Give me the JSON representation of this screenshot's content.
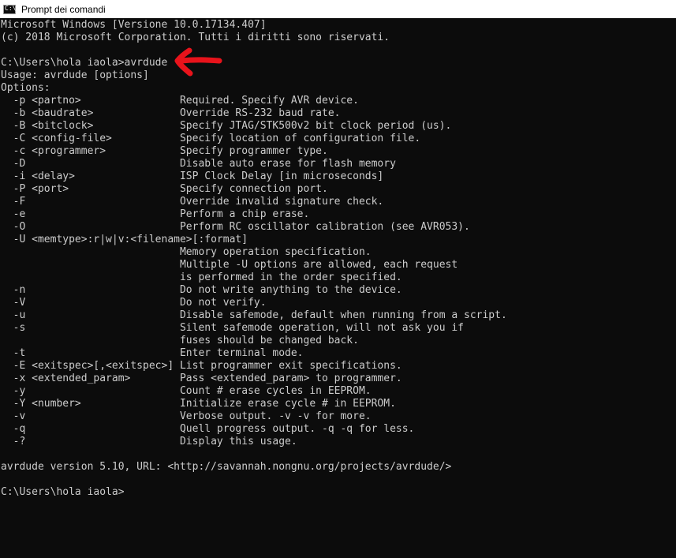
{
  "window": {
    "title": "Prompt dei comandi",
    "icon_label": "C:\\"
  },
  "console": {
    "lines": [
      "Microsoft Windows [Versione 10.0.17134.407]",
      "(c) 2018 Microsoft Corporation. Tutti i diritti sono riservati.",
      "",
      "C:\\Users\\hola iaola>avrdude",
      "Usage: avrdude [options]",
      "Options:",
      "  -p <partno>                Required. Specify AVR device.",
      "  -b <baudrate>              Override RS-232 baud rate.",
      "  -B <bitclock>              Specify JTAG/STK500v2 bit clock period (us).",
      "  -C <config-file>           Specify location of configuration file.",
      "  -c <programmer>            Specify programmer type.",
      "  -D                         Disable auto erase for flash memory",
      "  -i <delay>                 ISP Clock Delay [in microseconds]",
      "  -P <port>                  Specify connection port.",
      "  -F                         Override invalid signature check.",
      "  -e                         Perform a chip erase.",
      "  -O                         Perform RC oscillator calibration (see AVR053).",
      "  -U <memtype>:r|w|v:<filename>[:format]",
      "                             Memory operation specification.",
      "                             Multiple -U options are allowed, each request",
      "                             is performed in the order specified.",
      "  -n                         Do not write anything to the device.",
      "  -V                         Do not verify.",
      "  -u                         Disable safemode, default when running from a script.",
      "  -s                         Silent safemode operation, will not ask you if",
      "                             fuses should be changed back.",
      "  -t                         Enter terminal mode.",
      "  -E <exitspec>[,<exitspec>] List programmer exit specifications.",
      "  -x <extended_param>        Pass <extended_param> to programmer.",
      "  -y                         Count # erase cycles in EEPROM.",
      "  -Y <number>                Initialize erase cycle # in EEPROM.",
      "  -v                         Verbose output. -v -v for more.",
      "  -q                         Quell progress output. -q -q for less.",
      "  -?                         Display this usage.",
      "",
      "avrdude version 5.10, URL: <http://savannah.nongnu.org/projects/avrdude/>",
      "",
      "C:\\Users\\hola iaola>"
    ]
  },
  "annotation": {
    "arrow_color": "#e8131b"
  }
}
